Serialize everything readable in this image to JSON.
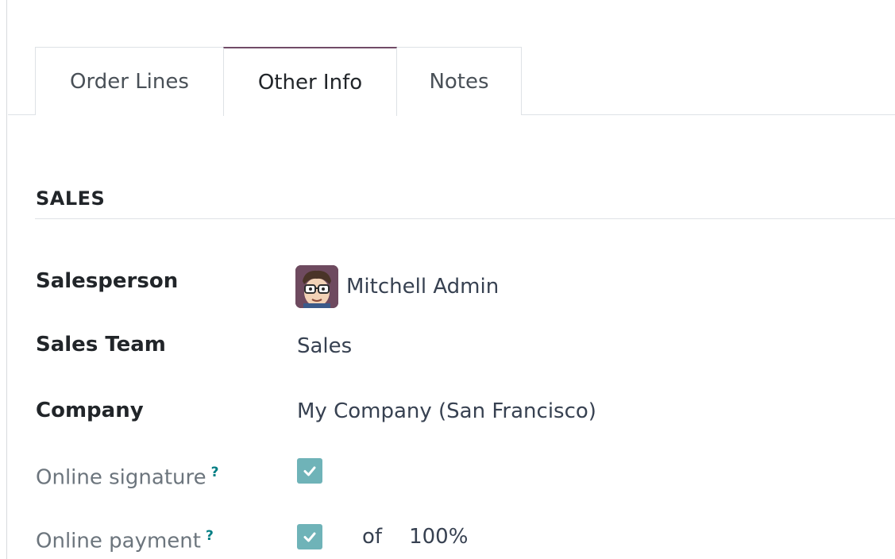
{
  "tabs": [
    {
      "label": "Order Lines"
    },
    {
      "label": "Other Info"
    },
    {
      "label": "Notes"
    }
  ],
  "active_tab": "Other Info",
  "section": {
    "title": "SALES"
  },
  "fields": {
    "salesperson": {
      "label": "Salesperson",
      "value": "Mitchell Admin",
      "avatar_icon": "user-avatar"
    },
    "sales_team": {
      "label": "Sales Team",
      "value": "Sales"
    },
    "company": {
      "label": "Company",
      "value": "My Company (San Francisco)"
    },
    "online_signature": {
      "label": "Online signature",
      "help": "?",
      "checked": true
    },
    "online_payment": {
      "label": "Online payment",
      "help": "?",
      "checked": true,
      "of_label": "of",
      "percent": "100%"
    }
  },
  "colors": {
    "active_tab_border": "#714b67",
    "checkbox": "#6fb3b8",
    "help_mark": "#017e84"
  }
}
